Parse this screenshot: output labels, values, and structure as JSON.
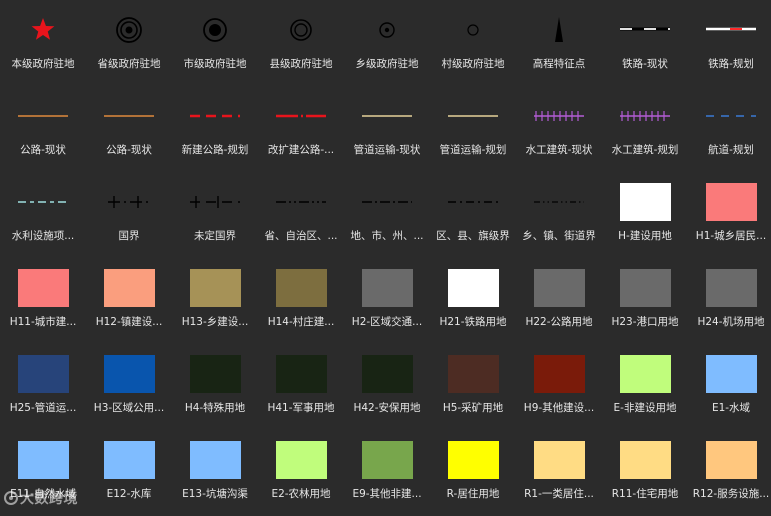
{
  "legend": [
    {
      "label": "本级政府驻地",
      "symbol": "star-icon",
      "color": "#e8141c"
    },
    {
      "label": "省级政府驻地",
      "symbol": "triple-ring-icon",
      "color": "#000000"
    },
    {
      "label": "市级政府驻地",
      "symbol": "ring-dot-icon",
      "color": "#000000"
    },
    {
      "label": "县级政府驻地",
      "symbol": "double-ring-icon",
      "color": "#000000"
    },
    {
      "label": "乡级政府驻地",
      "symbol": "small-ring-dot-icon",
      "color": "#000000"
    },
    {
      "label": "村级政府驻地",
      "symbol": "small-circle-icon",
      "color": "#000000"
    },
    {
      "label": "高程特征点",
      "symbol": "elevation-point-icon",
      "color": "#000000"
    },
    {
      "label": "铁路-现状",
      "symbol": "railway-existing-icon",
      "color": "#ffffff"
    },
    {
      "label": "铁路-规划",
      "symbol": "railway-planned-icon",
      "color": "#ff2a2a"
    },
    {
      "label": "公路-现状",
      "symbol": "line-orange-icon",
      "color": "#e08a3c"
    },
    {
      "label": "公路-现状",
      "symbol": "line-orange-icon",
      "color": "#e08a3c"
    },
    {
      "label": "新建公路-规划",
      "symbol": "dashed-red-line-icon",
      "color": "#e8141c"
    },
    {
      "label": "改扩建公路-...",
      "symbol": "dash-long-red-line-icon",
      "color": "#e8141c"
    },
    {
      "label": "管道运输-现状",
      "symbol": "line-tan-icon",
      "color": "#e6d29a"
    },
    {
      "label": "管道运输-规划",
      "symbol": "line-tan-icon",
      "color": "#e6d29a"
    },
    {
      "label": "水工建筑-现状",
      "symbol": "hatched-purple-line-icon",
      "color": "#b45cd6"
    },
    {
      "label": "水工建筑-规划",
      "symbol": "hatched-purple-line-icon",
      "color": "#b45cd6"
    },
    {
      "label": "航道-规划",
      "symbol": "dashed-blue-line-icon",
      "color": "#3a7bd5"
    },
    {
      "label": "水利设施项...",
      "symbol": "dashed-cyan-line-icon",
      "color": "#9fe0e0"
    },
    {
      "label": "国界",
      "symbol": "national-border-icon",
      "color": "#000000"
    },
    {
      "label": "未定国界",
      "symbol": "undefined-border-icon",
      "color": "#000000"
    },
    {
      "label": "省、自治区、...",
      "symbol": "province-border-icon",
      "color": "#000000"
    },
    {
      "label": "地、市、州、...",
      "symbol": "city-border-icon",
      "color": "#000000"
    },
    {
      "label": "区、县、旗级界",
      "symbol": "county-border-icon",
      "color": "#000000"
    },
    {
      "label": "乡、镇、街道界",
      "symbol": "township-border-icon",
      "color": "#000000"
    },
    {
      "label": "H-建设用地",
      "symbol": "swatch",
      "color": "#ffffff"
    },
    {
      "label": "H1-城乡居民...",
      "symbol": "swatch",
      "color": "#fa7a7a"
    },
    {
      "label": "H11-城市建...",
      "symbol": "swatch",
      "color": "#fa7a7a"
    },
    {
      "label": "H12-镇建设...",
      "symbol": "swatch",
      "color": "#fa9e7e"
    },
    {
      "label": "H13-乡建设...",
      "symbol": "swatch",
      "color": "#a69257"
    },
    {
      "label": "H14-村庄建...",
      "symbol": "swatch",
      "color": "#7d6e3f"
    },
    {
      "label": "H2-区域交通...",
      "symbol": "swatch",
      "color": "#6a6a6a"
    },
    {
      "label": "H21-铁路用地",
      "symbol": "swatch",
      "color": "#ffffff"
    },
    {
      "label": "H22-公路用地",
      "symbol": "swatch",
      "color": "#6a6a6a"
    },
    {
      "label": "H23-港口用地",
      "symbol": "swatch",
      "color": "#6a6a6a"
    },
    {
      "label": "H24-机场用地",
      "symbol": "swatch",
      "color": "#6a6a6a"
    },
    {
      "label": "H25-管道运...",
      "symbol": "swatch",
      "color": "#27447a"
    },
    {
      "label": "H3-区域公用...",
      "symbol": "swatch",
      "color": "#0955ad"
    },
    {
      "label": "H4-特殊用地",
      "symbol": "swatch",
      "color": "#182414"
    },
    {
      "label": "H41-军事用地",
      "symbol": "swatch",
      "color": "#182414"
    },
    {
      "label": "H42-安保用地",
      "symbol": "swatch",
      "color": "#182414"
    },
    {
      "label": "H5-采矿用地",
      "symbol": "swatch",
      "color": "#4d2c23"
    },
    {
      "label": "H9-其他建设...",
      "symbol": "swatch",
      "color": "#7a1b0a"
    },
    {
      "label": "E-非建设用地",
      "symbol": "swatch",
      "color": "#c0fd7c"
    },
    {
      "label": "E1-水域",
      "symbol": "swatch",
      "color": "#7fbcff"
    },
    {
      "label": "E11-自然水域",
      "symbol": "swatch",
      "color": "#7fbcff"
    },
    {
      "label": "E12-水库",
      "symbol": "swatch",
      "color": "#7fbcff"
    },
    {
      "label": "E13-坑塘沟渠",
      "symbol": "swatch",
      "color": "#7fbcff"
    },
    {
      "label": "E2-农林用地",
      "symbol": "swatch",
      "color": "#c0fd7c"
    },
    {
      "label": "E9-其他非建...",
      "symbol": "swatch",
      "color": "#78a64c"
    },
    {
      "label": "R-居住用地",
      "symbol": "swatch",
      "color": "#ffff00"
    },
    {
      "label": "R1-一类居住...",
      "symbol": "swatch",
      "color": "#ffdc84"
    },
    {
      "label": "R11-住宅用地",
      "symbol": "swatch",
      "color": "#ffdc84"
    },
    {
      "label": "R12-服务设施...",
      "symbol": "swatch",
      "color": "#ffc77e"
    }
  ],
  "watermark": {
    "text": "大数跨境"
  }
}
